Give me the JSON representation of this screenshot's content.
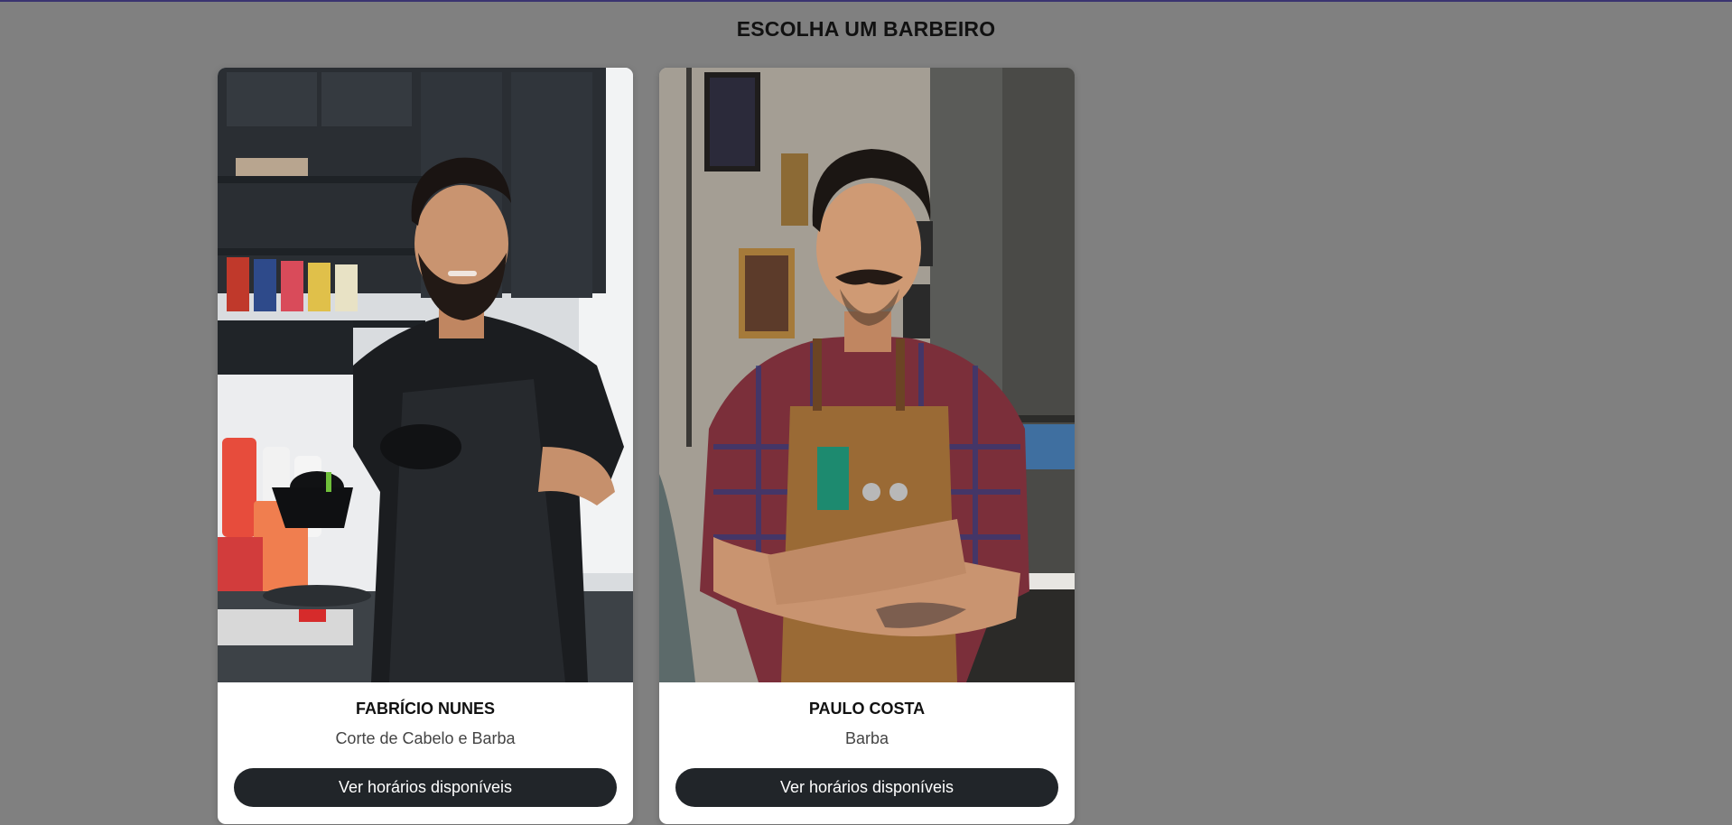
{
  "page": {
    "title": "ESCOLHA UM BARBEIRO"
  },
  "barbers": [
    {
      "name": "FABRÍCIO NUNES",
      "specialty": "Corte de Cabelo e Barba",
      "button_label": "Ver horários disponíveis",
      "photo_alt": "Fabrício Nunes"
    },
    {
      "name": "PAULO COSTA",
      "specialty": "Barba",
      "button_label": "Ver horários disponíveis",
      "photo_alt": "Paulo Costa"
    }
  ],
  "colors": {
    "page_background": "#808080",
    "card_background": "#ffffff",
    "button_background": "#212529",
    "button_text": "#ffffff",
    "top_border": "#3a3470"
  }
}
